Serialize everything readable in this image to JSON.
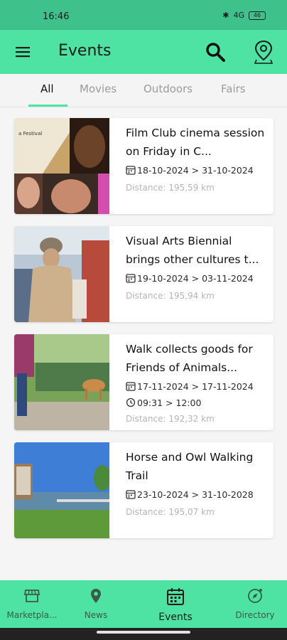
{
  "status": {
    "time": "16:46",
    "battery": "46",
    "signal": "4G"
  },
  "app_bar": {
    "title": "Events",
    "menu_icon": "menu-icon",
    "search_icon": "search-icon",
    "location_icon": "location-pin-icon"
  },
  "tabs": [
    {
      "label": "All",
      "active": true
    },
    {
      "label": "Movies",
      "active": false
    },
    {
      "label": "Outdoors",
      "active": false
    },
    {
      "label": "Fairs",
      "active": false
    }
  ],
  "events": [
    {
      "title": "Film Club cinema session on Friday in C...",
      "dates": "18-10-2024 > 31-10-2024",
      "time": "",
      "distance": "Distance: 195,59 km"
    },
    {
      "title": "Visual Arts Biennial brings other cultures t...",
      "dates": "19-10-2024 > 03-11-2024",
      "time": "",
      "distance": "Distance: 195,94 km"
    },
    {
      "title": "Walk collects goods for Friends of Animals...",
      "dates": "17-11-2024 > 17-11-2024",
      "time": "09:31 > 12:00",
      "distance": "Distance: 192,32 km"
    },
    {
      "title": "Horse and Owl Walking Trail",
      "dates": "23-10-2024 > 31-10-2028",
      "time": "",
      "distance": "Distance: 195,07 km"
    }
  ],
  "bottom_nav": [
    {
      "label": "Marketpla...",
      "icon": "store-icon",
      "active": false
    },
    {
      "label": "News",
      "icon": "map-pin-icon",
      "active": false
    },
    {
      "label": "Events",
      "icon": "calendar-icon",
      "active": true
    },
    {
      "label": "Directory",
      "icon": "compass-icon",
      "active": false
    }
  ],
  "colors": {
    "primary": "#4ee3a2",
    "status_bar": "#3fc18b"
  }
}
